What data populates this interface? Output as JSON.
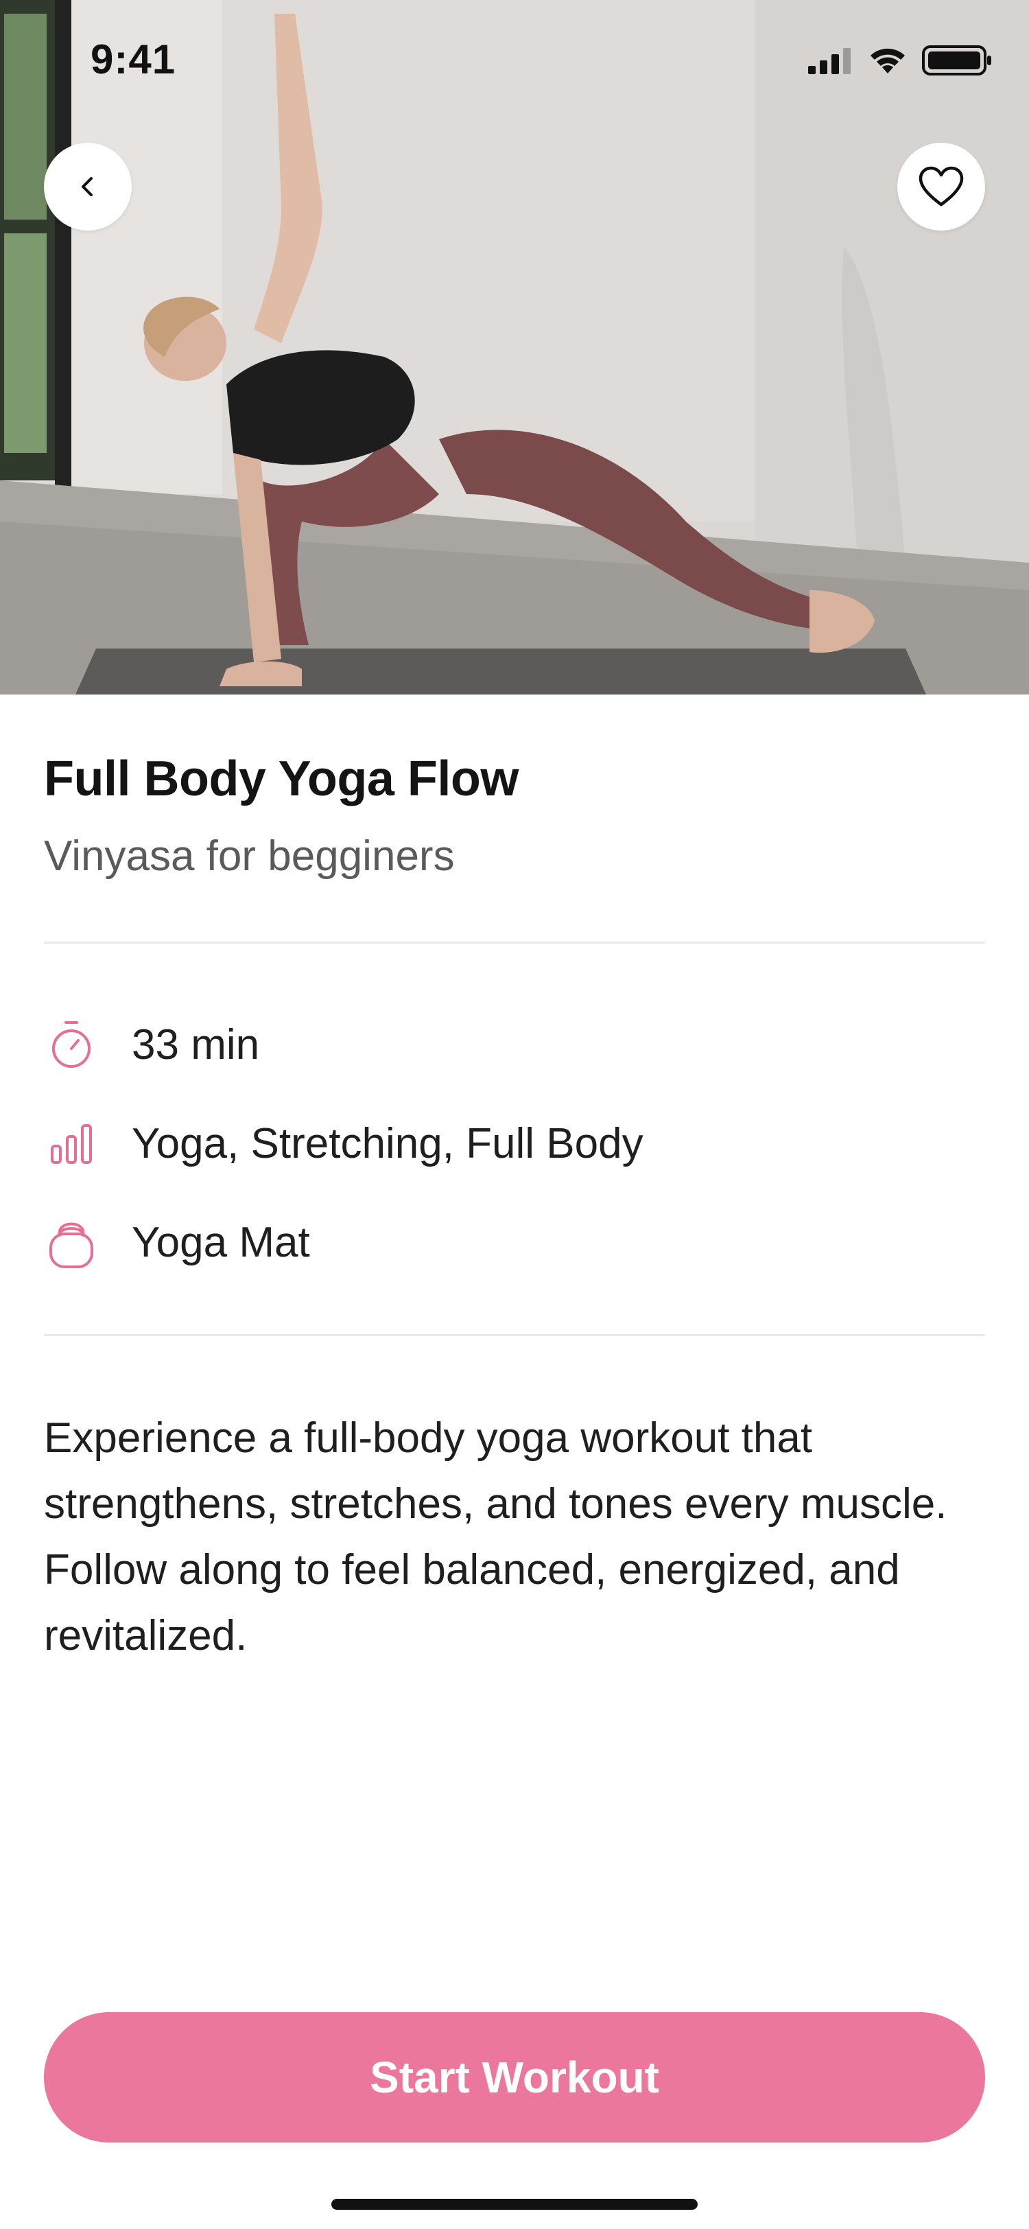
{
  "status_bar": {
    "time": "9:41"
  },
  "hero": {
    "image_alt": "Woman in extended side angle yoga pose on a mat",
    "back_icon": "chevron-left-icon",
    "favorite_icon": "heart-outline-icon"
  },
  "workout": {
    "title": "Full Body Yoga Flow",
    "subtitle": "Vinyasa for begginers",
    "duration": "33 min",
    "categories": "Yoga, Stretching, Full Body",
    "equipment": "Yoga Mat",
    "description": "Experience a full-body yoga workout that strengthens, stretches, and tones every muscle. Follow along to feel balanced, energized, and revitalized."
  },
  "cta": {
    "label": "Start Workout"
  },
  "colors": {
    "accent": "#ec779d",
    "title": "#141414",
    "subtitle": "#5a5a5a",
    "divider": "#e9e9e9"
  }
}
